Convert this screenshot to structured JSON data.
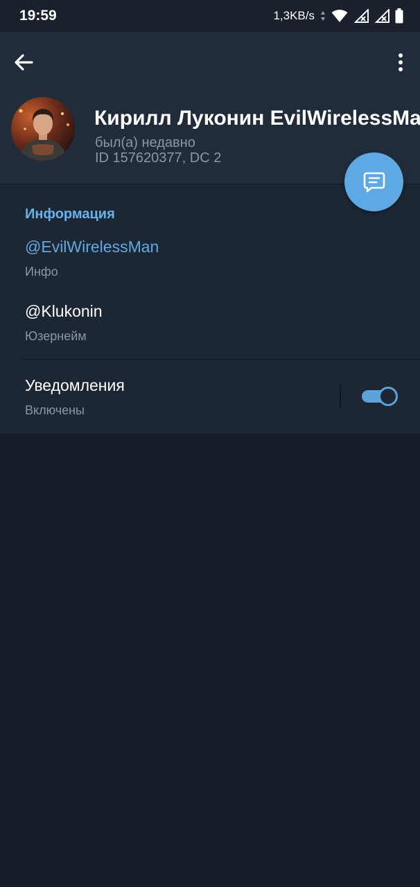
{
  "status_bar": {
    "time": "19:59",
    "net_speed": "1,3KB/s"
  },
  "toolbar": {
    "back_icon": "arrow-left-icon",
    "menu_icon": "more-vert-icon"
  },
  "profile": {
    "name": "Кирилл Луконин EvilWirelessMan",
    "status": "был(а) недавно",
    "id_line": "ID 157620377, DC 2",
    "fab_icon": "message-icon"
  },
  "info": {
    "section_title": "Информация",
    "rows": [
      {
        "value": "@EvilWirelessMan",
        "label": "Инфо"
      },
      {
        "value": "@Klukonin",
        "label": "Юзернейм"
      }
    ],
    "notifications": {
      "title": "Уведомления",
      "subtitle": "Включены",
      "enabled": true
    }
  },
  "colors": {
    "accent": "#5ea9e3",
    "link": "#62a8e2",
    "header_bg": "#212c3b",
    "section_bg": "#1d2633",
    "page_bg": "#171d27"
  }
}
